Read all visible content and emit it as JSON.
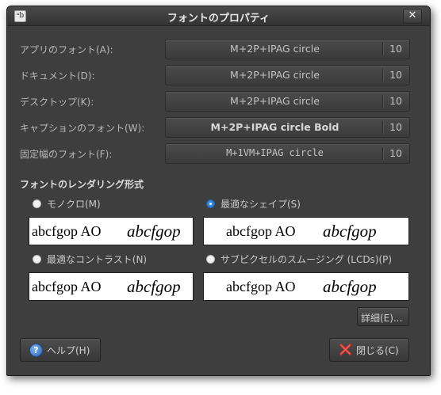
{
  "window": {
    "title": "フォントのプロパティ",
    "close_glyph": "✕",
    "icon_glyph": "ᵃb"
  },
  "fonts": [
    {
      "label": "アプリのフォント(A):",
      "font": "M+2P+IPAG circle",
      "size": "10"
    },
    {
      "label": "ドキュメント(D):",
      "font": "M+2P+IPAG circle",
      "size": "10"
    },
    {
      "label": "デスクトップ(K):",
      "font": "M+2P+IPAG circle",
      "size": "10"
    },
    {
      "label": "キャプションのフォント(W):",
      "font": "M+2P+IPAG circle Bold",
      "size": "10"
    },
    {
      "label": "固定幅のフォント(F):",
      "font": "M+1VM+IPAG circle",
      "size": "10"
    }
  ],
  "rendering": {
    "title": "フォントのレンダリング形式",
    "options": [
      {
        "label": "モノクロ(M)",
        "selected": false
      },
      {
        "label": "最適なシェイプ(S)",
        "selected": true
      },
      {
        "label": "最適なコントラスト(N)",
        "selected": false
      },
      {
        "label": "サブピクセルのスムージング (LCDs)(P)",
        "selected": false
      }
    ],
    "preview_plain": "abcfgop AO",
    "preview_italic": "abcfgop"
  },
  "buttons": {
    "details": "詳細(E)...",
    "help": "ヘルプ(H)",
    "close": "閉じる(C)"
  },
  "colors": {
    "selected_radio": "#2f85e0",
    "close_icon": "#d8322b"
  }
}
